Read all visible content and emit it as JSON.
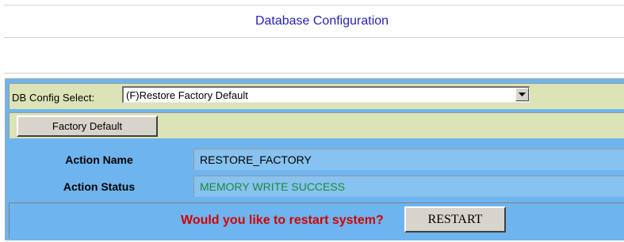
{
  "title": "Database Configuration",
  "config_select": {
    "label": "DB Config Select:",
    "selected": "(F)Restore Factory Default"
  },
  "factory_button_label": "Factory Default",
  "action_name": {
    "label": "Action Name",
    "value": "RESTORE_FACTORY"
  },
  "action_status": {
    "label": "Action Status",
    "value": "MEMORY WRITE SUCCESS"
  },
  "restart": {
    "question": "Would you like to restart system?",
    "button_label": "RESTART"
  },
  "icons": {
    "select_arrow": "dropdown-arrow-icon"
  },
  "colors": {
    "title_text": "#2525b5",
    "panel_blue": "#6eb4ee",
    "value_cell_blue": "#87c2f0",
    "row_khaki": "#dbe3b7",
    "status_green": "#1b8a3d",
    "question_red": "#d30000"
  }
}
